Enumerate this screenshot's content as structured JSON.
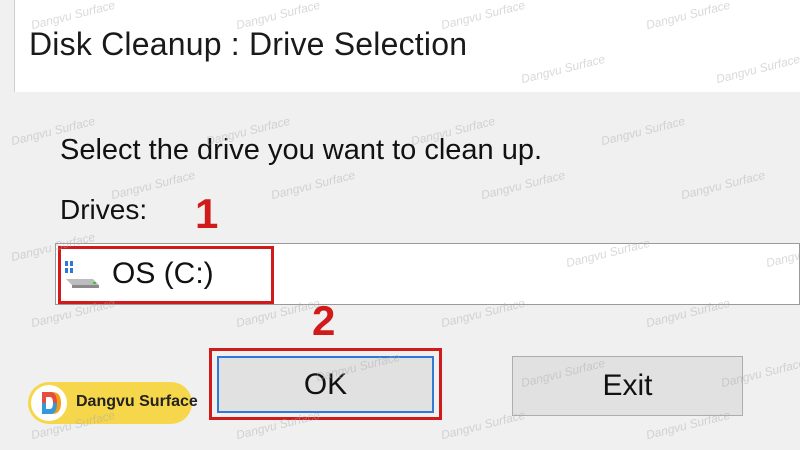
{
  "window": {
    "title": "Disk Cleanup : Drive Selection"
  },
  "dialog": {
    "prompt": "Select the drive you want to clean up.",
    "drives_label": "Drives:",
    "selected_drive": "OS (C:)",
    "ok_label": "OK",
    "exit_label": "Exit"
  },
  "annotations": {
    "step1": "1",
    "step2": "2",
    "highlight_color": "#d11a1a"
  },
  "badge": {
    "text": "Dangvu Surface",
    "color": "#f6d64a"
  },
  "watermark": {
    "text": "Dangvu Surface"
  },
  "icons": {
    "drive": "hard-drive-icon",
    "logo": "dangvu-logo-icon"
  }
}
